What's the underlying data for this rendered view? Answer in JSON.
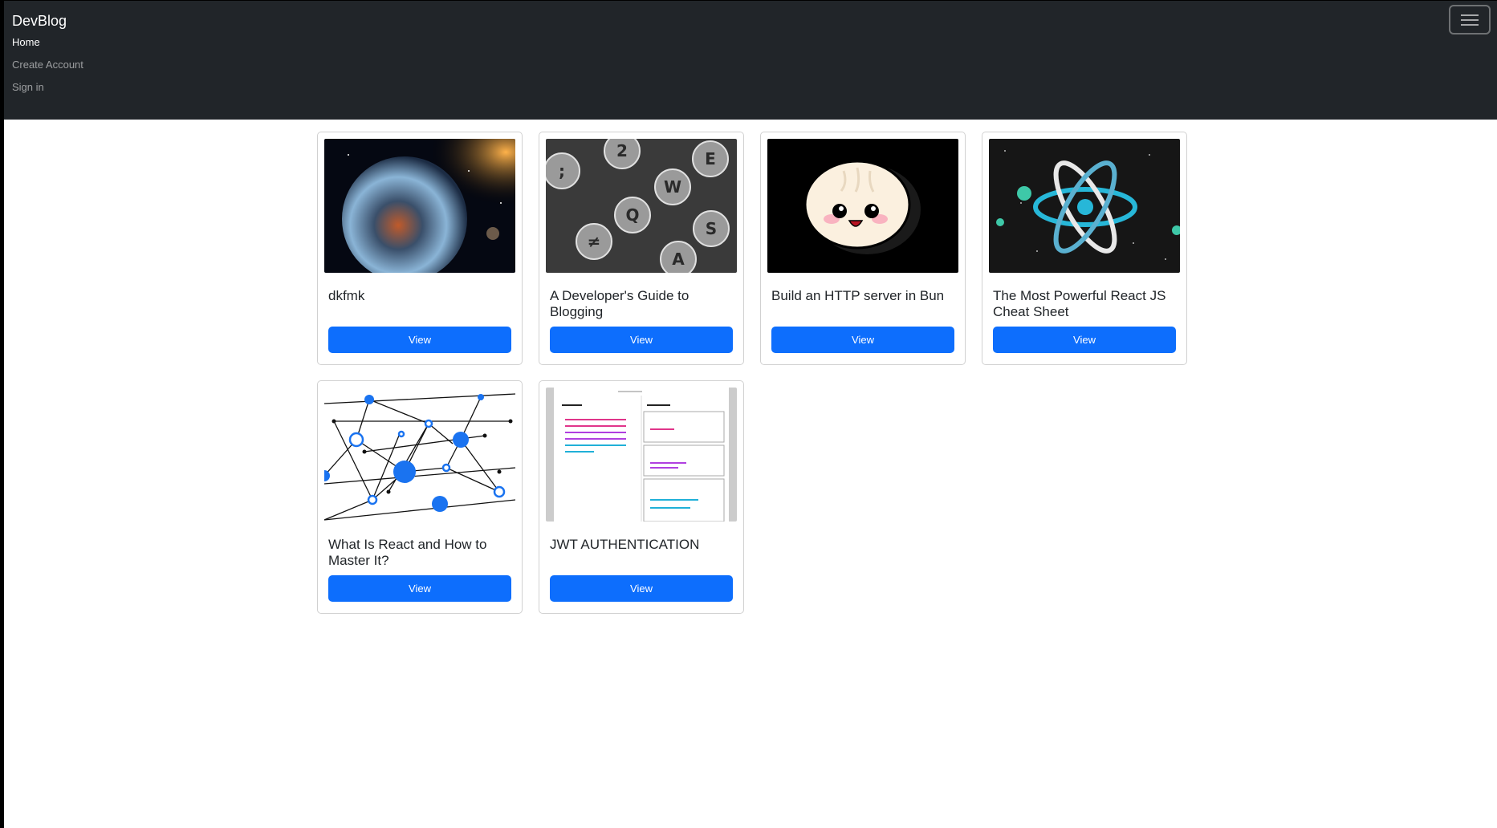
{
  "navbar": {
    "brand": "DevBlog",
    "links": [
      {
        "label": "Home",
        "active": true
      },
      {
        "label": "Create Account",
        "active": false
      },
      {
        "label": "Sign in",
        "active": false
      }
    ],
    "toggler_icon": "menu-icon"
  },
  "posts": [
    {
      "title": "dkfmk",
      "button": "View",
      "image": "earth-space-image"
    },
    {
      "title": "A Developer's Guide to Blogging",
      "button": "View",
      "image": "typewriter-keys-image"
    },
    {
      "title": "Build an HTTP server in Bun",
      "button": "View",
      "image": "bun-logo-image"
    },
    {
      "title": "The Most Powerful React JS Cheat Sheet",
      "button": "View",
      "image": "react-atom-image"
    },
    {
      "title": "What Is React and How to Master It?",
      "button": "View",
      "image": "network-graph-image"
    },
    {
      "title": "JWT AUTHENTICATION",
      "button": "View",
      "image": "jwt-decoder-image"
    }
  ],
  "colors": {
    "navbar_bg": "#212529",
    "primary": "#0d6efd"
  }
}
